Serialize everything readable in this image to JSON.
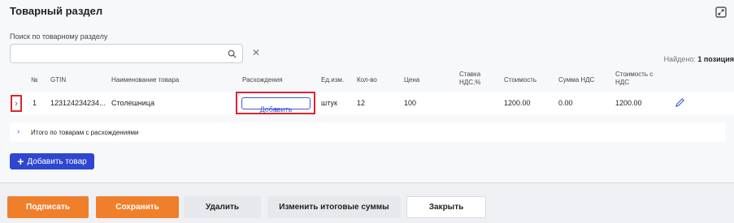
{
  "section": {
    "title": "Товарный раздел",
    "search_label": "Поиск по товарному разделу",
    "search_value": "",
    "found_prefix": "Найдено:",
    "found_value": "1 позиция"
  },
  "table": {
    "headers": {
      "num": "№",
      "gtin": "GTIN",
      "name": "Наименование товара",
      "discrepancies": "Расхождения",
      "unit": "Ед.изм.",
      "qty": "Кол-во",
      "price": "Цена",
      "vat_rate_1": "Ставка",
      "vat_rate_2": "НДС,%",
      "cost": "Стоимость",
      "vat_sum": "Сумма НДС",
      "cost_vat_1": "Стоимость с",
      "cost_vat_2": "НДС"
    },
    "rows": [
      {
        "num": "1",
        "gtin": "123124234234...",
        "name": "Столешница",
        "add_label": "Добавить",
        "unit": "штук",
        "qty": "12",
        "price": "100",
        "vat_rate": "",
        "cost": "1200.00",
        "vat_sum": "0.00",
        "cost_vat": "1200.00"
      }
    ]
  },
  "summary": {
    "label": "Итого по товарам с расхождениями"
  },
  "add_goods_label": "Добавить товар",
  "actions": {
    "sign": "Подписать",
    "save": "Сохранить",
    "delete": "Удалить",
    "change_totals": "Изменить итоговые суммы",
    "close": "Закрыть"
  },
  "colors": {
    "accent_blue": "#2f46d1",
    "orange": "#f07f2b",
    "highlight_red": "#e0232e"
  }
}
